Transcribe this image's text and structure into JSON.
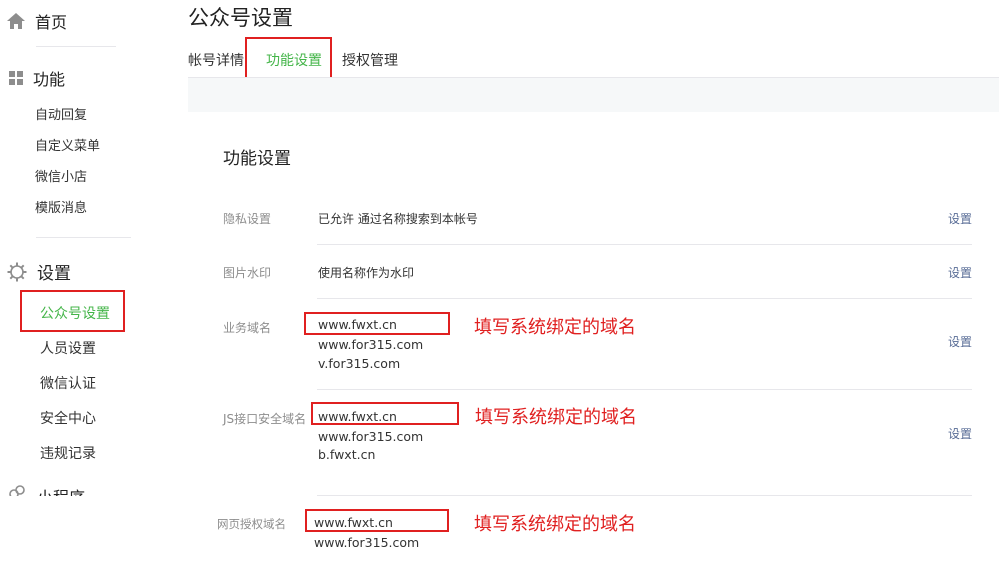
{
  "sidebar": {
    "home": "首页",
    "function": {
      "label": "功能",
      "items": [
        "自动回复",
        "自定义菜单",
        "微信小店",
        "模版消息"
      ]
    },
    "settings": {
      "label": "设置",
      "items": [
        "公众号设置",
        "人员设置",
        "微信认证",
        "安全中心",
        "违规记录"
      ]
    },
    "miniprogram": "小程序"
  },
  "page": {
    "title": "公众号设置",
    "tabs": [
      "帐号详情",
      "功能设置",
      "授权管理"
    ],
    "active_tab": "功能设置"
  },
  "section": {
    "title": "功能设置",
    "rows": [
      {
        "label": "隐私设置",
        "value": "已允许 通过名称搜索到本帐号",
        "action": "设置"
      },
      {
        "label": "图片水印",
        "value": "使用名称作为水印",
        "action": "设置"
      },
      {
        "label": "业务域名",
        "domains": [
          "www.fwxt.cn",
          "www.for315.com",
          "v.for315.com"
        ],
        "action": "设置"
      },
      {
        "label": "JS接口安全域名",
        "domains": [
          "www.fwxt.cn",
          "www.for315.com",
          "b.fwxt.cn"
        ],
        "action": "设置"
      },
      {
        "label": "网页授权域名",
        "domains": [
          "www.fwxt.cn",
          "www.for315.com"
        ]
      }
    ]
  },
  "annotation": {
    "text": "填写系统绑定的域名",
    "color": "#e02020"
  },
  "colors": {
    "accent": "#44b549",
    "link": "#576b95",
    "highlight": "#e02020"
  }
}
